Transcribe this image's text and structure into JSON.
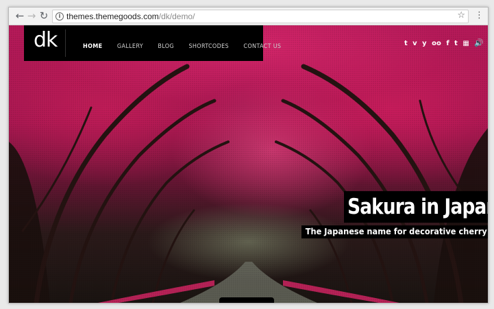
{
  "browser": {
    "back_icon": "back-arrow-icon",
    "forward_icon": "forward-arrow-icon",
    "reload_icon": "reload-icon",
    "url_host": "themes.themegoods.com",
    "url_path": "/dk/demo/",
    "star_icon": "bookmark-star-icon",
    "menu_icon": "kebab-menu-icon"
  },
  "site": {
    "logo": "dk",
    "nav": [
      {
        "label": "HOME",
        "active": true
      },
      {
        "label": "GALLERY"
      },
      {
        "label": "BLOG"
      },
      {
        "label": "SHORTCODES"
      },
      {
        "label": "CONTACT US"
      }
    ],
    "social": [
      "t",
      "v",
      "y",
      "oo",
      "f",
      "t"
    ],
    "hero": {
      "title": "Sakura in Japan",
      "subtitle": "The Japanese name for decorative cherry trees"
    }
  },
  "colors": {
    "accent": "#c2185b",
    "header_bg": "#000000"
  }
}
